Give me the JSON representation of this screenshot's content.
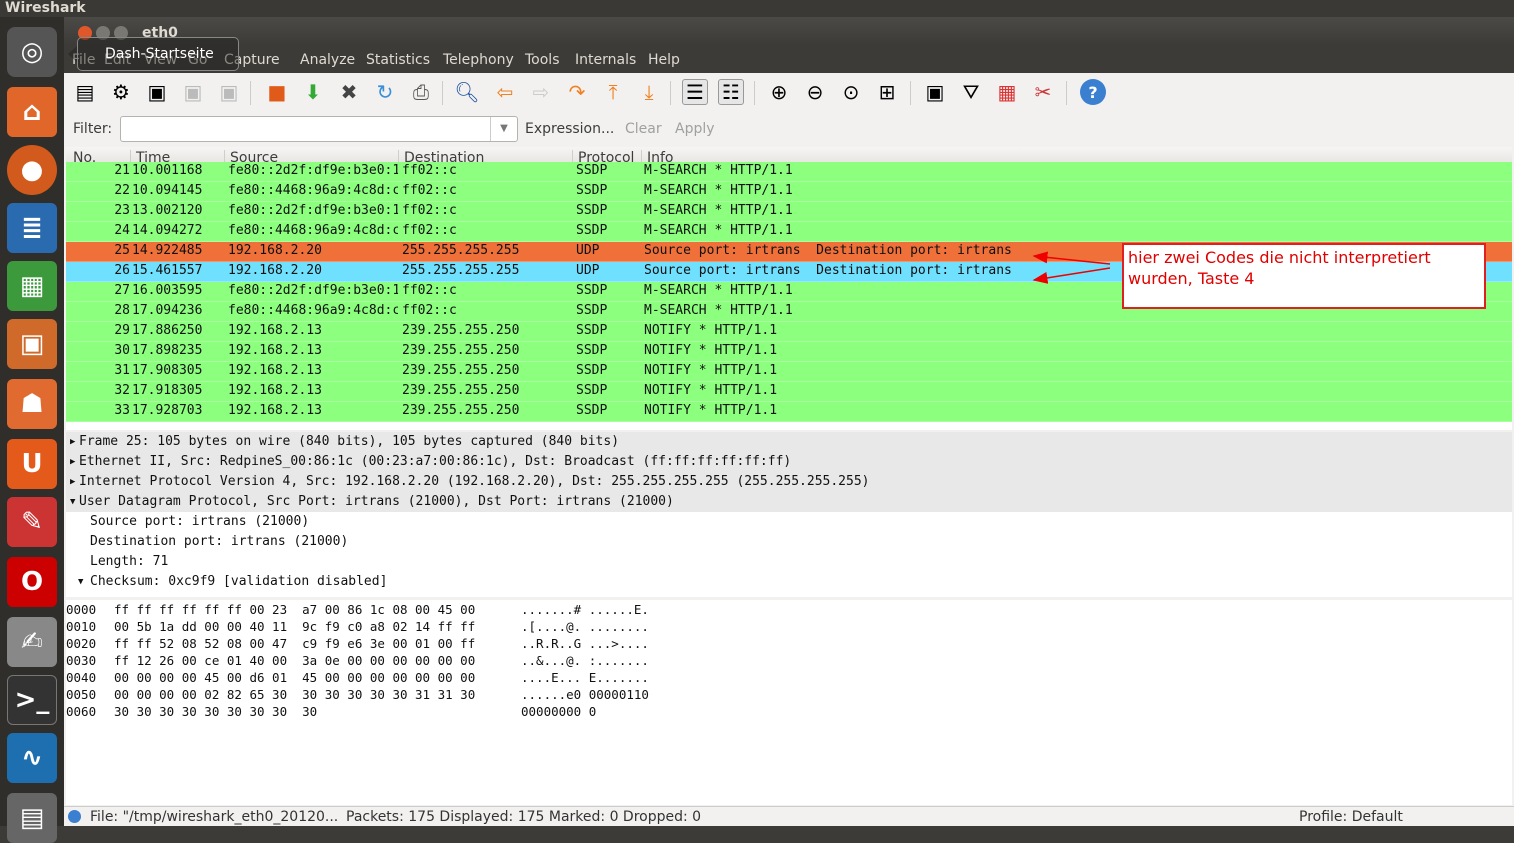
{
  "topbar": {
    "app_name": "Wireshark"
  },
  "launcher": {
    "tooltip": "Dash-Startseite",
    "items": [
      "dash-icon",
      "files-icon",
      "firefox-icon",
      "writer-icon",
      "calc-icon",
      "impress-icon",
      "software-center-icon",
      "ubuntu-one-icon",
      "system-settings-icon",
      "opera-icon",
      "text-editor-icon",
      "terminal-icon",
      "wireshark-icon",
      "workspace-icon"
    ]
  },
  "window": {
    "title": "eth0"
  },
  "menu": [
    "File",
    "Edit",
    "View",
    "Go",
    "Capture",
    "Analyze",
    "Statistics",
    "Telephony",
    "Tools",
    "Internals",
    "Help"
  ],
  "filter": {
    "label": "Filter:",
    "value": "",
    "expression": "Expression...",
    "clear": "Clear",
    "apply": "Apply"
  },
  "packet_list": {
    "columns": [
      "No.",
      "Time",
      "Source",
      "Destination",
      "Protocol",
      "Info"
    ],
    "colors": {
      "ssdp": "#8cff7f",
      "udp_selected": "#f0703a",
      "udp": "#70e0ff"
    },
    "rows": [
      {
        "no": "21",
        "time": "10.001168",
        "src": "fe80::2d2f:df9e:b3e0:1",
        "dst": "ff02::c",
        "proto": "SSDP",
        "info": "M-SEARCH * HTTP/1.1",
        "style": "ssdp"
      },
      {
        "no": "22",
        "time": "10.094145",
        "src": "fe80::4468:96a9:4c8d:c",
        "dst": "ff02::c",
        "proto": "SSDP",
        "info": "M-SEARCH * HTTP/1.1",
        "style": "ssdp"
      },
      {
        "no": "23",
        "time": "13.002120",
        "src": "fe80::2d2f:df9e:b3e0:1",
        "dst": "ff02::c",
        "proto": "SSDP",
        "info": "M-SEARCH * HTTP/1.1",
        "style": "ssdp"
      },
      {
        "no": "24",
        "time": "14.094272",
        "src": "fe80::4468:96a9:4c8d:c",
        "dst": "ff02::c",
        "proto": "SSDP",
        "info": "M-SEARCH * HTTP/1.1",
        "style": "ssdp"
      },
      {
        "no": "25",
        "time": "14.922485",
        "src": "192.168.2.20",
        "dst": "255.255.255.255",
        "proto": "UDP",
        "info": "Source port: irtrans  Destination port: irtrans",
        "style": "udp_selected"
      },
      {
        "no": "26",
        "time": "15.461557",
        "src": "192.168.2.20",
        "dst": "255.255.255.255",
        "proto": "UDP",
        "info": "Source port: irtrans  Destination port: irtrans",
        "style": "udp"
      },
      {
        "no": "27",
        "time": "16.003595",
        "src": "fe80::2d2f:df9e:b3e0:1",
        "dst": "ff02::c",
        "proto": "SSDP",
        "info": "M-SEARCH * HTTP/1.1",
        "style": "ssdp"
      },
      {
        "no": "28",
        "time": "17.094236",
        "src": "fe80::4468:96a9:4c8d:c",
        "dst": "ff02::c",
        "proto": "SSDP",
        "info": "M-SEARCH * HTTP/1.1",
        "style": "ssdp"
      },
      {
        "no": "29",
        "time": "17.886250",
        "src": "192.168.2.13",
        "dst": "239.255.255.250",
        "proto": "SSDP",
        "info": "NOTIFY * HTTP/1.1",
        "style": "ssdp"
      },
      {
        "no": "30",
        "time": "17.898235",
        "src": "192.168.2.13",
        "dst": "239.255.255.250",
        "proto": "SSDP",
        "info": "NOTIFY * HTTP/1.1",
        "style": "ssdp"
      },
      {
        "no": "31",
        "time": "17.908305",
        "src": "192.168.2.13",
        "dst": "239.255.255.250",
        "proto": "SSDP",
        "info": "NOTIFY * HTTP/1.1",
        "style": "ssdp"
      },
      {
        "no": "32",
        "time": "17.918305",
        "src": "192.168.2.13",
        "dst": "239.255.255.250",
        "proto": "SSDP",
        "info": "NOTIFY * HTTP/1.1",
        "style": "ssdp"
      },
      {
        "no": "33",
        "time": "17.928703",
        "src": "192.168.2.13",
        "dst": "239.255.255.250",
        "proto": "SSDP",
        "info": "NOTIFY * HTTP/1.1",
        "style": "ssdp"
      }
    ]
  },
  "details": [
    {
      "text": "Frame 25: 105 bytes on wire (840 bits), 105 bytes captured (840 bits)",
      "expander": "▶",
      "indent": 0,
      "hl": true
    },
    {
      "text": "Ethernet II, Src: RedpineS_00:86:1c (00:23:a7:00:86:1c), Dst: Broadcast (ff:ff:ff:ff:ff:ff)",
      "expander": "▶",
      "indent": 0,
      "hl": true
    },
    {
      "text": "Internet Protocol Version 4, Src: 192.168.2.20 (192.168.2.20), Dst: 255.255.255.255 (255.255.255.255)",
      "expander": "▶",
      "indent": 0,
      "hl": true
    },
    {
      "text": "User Datagram Protocol, Src Port: irtrans (21000), Dst Port: irtrans (21000)",
      "expander": "▼",
      "indent": 0,
      "hl": true
    },
    {
      "text": "Source port: irtrans (21000)",
      "expander": "",
      "indent": 1,
      "hl": false
    },
    {
      "text": "Destination port: irtrans (21000)",
      "expander": "",
      "indent": 1,
      "hl": false
    },
    {
      "text": "Length: 71",
      "expander": "",
      "indent": 1,
      "hl": false
    },
    {
      "text": "Checksum: 0xc9f9 [validation disabled]",
      "expander": "▼",
      "indent": 1,
      "hl": false
    }
  ],
  "hex": [
    {
      "off": "0000",
      "bytes": "ff ff ff ff ff ff 00 23  a7 00 86 1c 08 00 45 00",
      "ascii": ".......# ......E."
    },
    {
      "off": "0010",
      "bytes": "00 5b 1a dd 00 00 40 11  9c f9 c0 a8 02 14 ff ff",
      "ascii": ".[....@. ........"
    },
    {
      "off": "0020",
      "bytes": "ff ff 52 08 52 08 00 47  c9 f9 e6 3e 00 01 00 ff",
      "ascii": "..R.R..G ...>...."
    },
    {
      "off": "0030",
      "bytes": "ff 12 26 00 ce 01 40 00  3a 0e 00 00 00 00 00 00",
      "ascii": "..&...@. :......."
    },
    {
      "off": "0040",
      "bytes": "00 00 00 00 45 00 d6 01  45 00 00 00 00 00 00 00",
      "ascii": "....E... E......."
    },
    {
      "off": "0050",
      "bytes": "00 00 00 00 02 82 65 30  30 30 30 30 30 31 31 30",
      "ascii": "......e0 00000110"
    },
    {
      "off": "0060",
      "bytes": "30 30 30 30 30 30 30 30  30",
      "ascii": "00000000 0"
    }
  ],
  "status": {
    "file": "File: \"/tmp/wireshark_eth0_20120...",
    "packets": "Packets: 175 Displayed: 175 Marked: 0 Dropped: 0",
    "profile": "Profile: Default"
  },
  "annotation": {
    "text": "hier zwei Codes die nicht interpretiert wurden, Taste 4",
    "color": "#e00000"
  }
}
